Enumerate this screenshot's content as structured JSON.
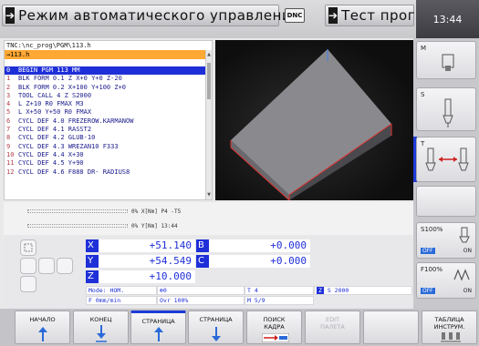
{
  "header": {
    "mode_title": "Режим автоматического управления",
    "dnc_label": "DNC",
    "test_mode_title": "Тест прогр.",
    "clock": "13:44"
  },
  "program": {
    "path": "TNC:\\nc_prog\\PGM\\113.h",
    "file_tab": "→113.h",
    "lines": [
      {
        "n": "0",
        "text": "BEGIN PGM 113 MM"
      },
      {
        "n": "1",
        "text": "BLK FORM 0.1 Z X+0 Y+0 Z-20"
      },
      {
        "n": "2",
        "text": "BLK FORM 0.2  X+100  Y+100  Z+0"
      },
      {
        "n": "3",
        "text": "TOOL CALL 4 Z S2000"
      },
      {
        "n": "4",
        "text": "L  Z+10 R0 FMAX M3"
      },
      {
        "n": "5",
        "text": "L  X+50  Y+50 R0 FMAX"
      },
      {
        "n": "6",
        "text": "CYCL DEF 4.0 FREZEROW.KARMANOW"
      },
      {
        "n": "7",
        "text": "CYCL DEF 4.1 RASST2"
      },
      {
        "n": "8",
        "text": "CYCL DEF 4.2 GLUB-10"
      },
      {
        "n": "9",
        "text": "CYCL DEF 4.3 WREZAN10 F333"
      },
      {
        "n": "10",
        "text": "CYCL DEF 4.4 X+30"
      },
      {
        "n": "11",
        "text": "CYCL DEF 4.5 Y+90"
      },
      {
        "n": "12",
        "text": "CYCL DEF 4.6 F888 DR- RADIUS8"
      }
    ]
  },
  "status": {
    "line1": "0% X[Nm] P4  -T5",
    "line2": "0% Y[Nm] 13:44"
  },
  "positions": {
    "x_label": "X",
    "x_value": "+51.140",
    "b_label": "B",
    "b_value": "+0.000",
    "y_label": "Y",
    "y_value": "+54.549",
    "c_label": "C",
    "c_value": "+0.000",
    "z_label": "Z",
    "z_value": "+10.000",
    "mode": "Mode: НОМ.",
    "zero": "0",
    "tool": "T 4",
    "feed": "F 0mm/min",
    "ovr": "Ovr 100%",
    "m": "M 5/9",
    "spindle_z": "Z",
    "spindle": "S 2000"
  },
  "right_panel": {
    "m_label": "M",
    "s_label": "S",
    "t_label": "T",
    "s_override": "S100%",
    "f_override": "F100%",
    "off": "OFF",
    "on": "ON"
  },
  "softkeys": [
    {
      "label": "НАЧАЛО",
      "icon": "arrow-up-icon"
    },
    {
      "label": "КОНЕЦ",
      "icon": "arrow-down-icon"
    },
    {
      "label": "СТРАНИЦА",
      "icon": "arrow-up-icon"
    },
    {
      "label": "СТРАНИЦА",
      "icon": "arrow-down-icon"
    },
    {
      "label": "ПОИСК\nКАДРА",
      "icon": "block-scan-icon"
    },
    {
      "label": "EDIT\nПАЛЕТА",
      "icon": ""
    },
    {
      "label": "",
      "icon": ""
    },
    {
      "label": "ТАБЛИЦА\nИНСТРУМ.",
      "icon": "tool-table-icon"
    }
  ],
  "colors": {
    "accent_blue": "#1e2fd8",
    "file_orange": "#ffa833",
    "model_face": "#8a8a8e",
    "model_edge": "#e03030"
  }
}
